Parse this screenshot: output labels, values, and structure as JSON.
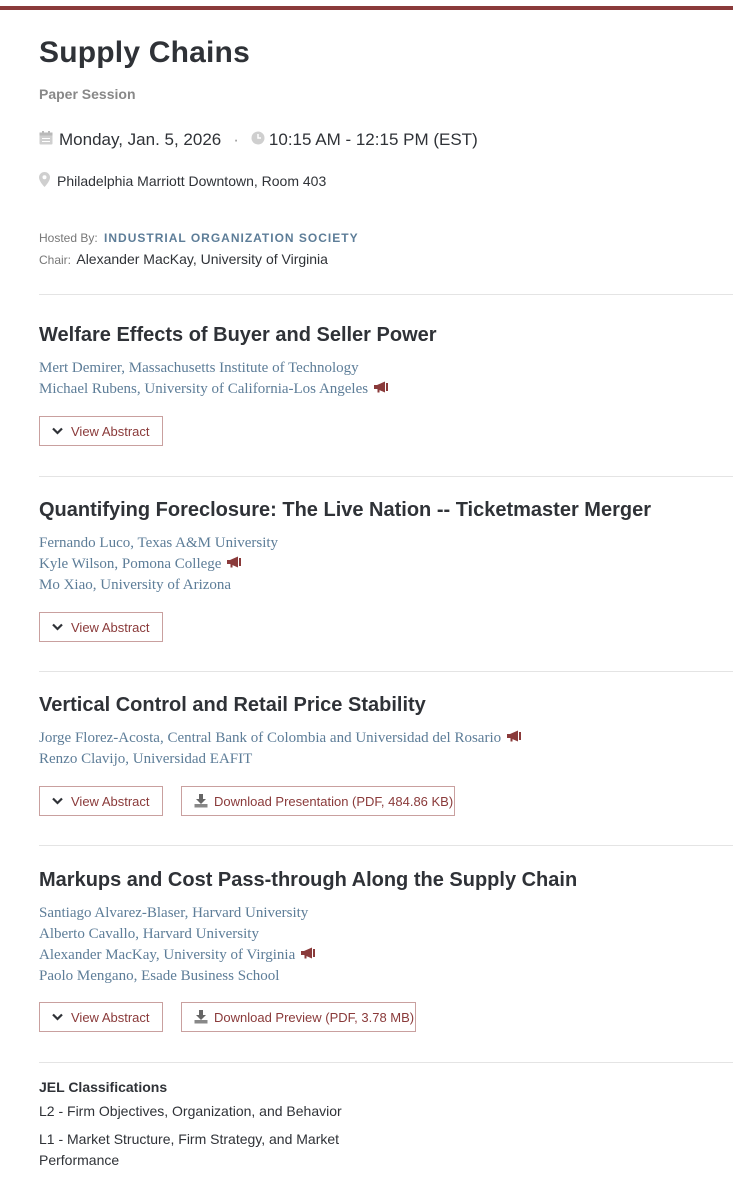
{
  "session": {
    "title": "Supply Chains",
    "type": "Paper Session",
    "date": "Monday, Jan. 5, 2026",
    "separator": "·",
    "time": "10:15 AM - 12:15 PM (EST)",
    "location": "Philadelphia Marriott Downtown, Room 403",
    "hosted_label": "Hosted By:",
    "hosted_by": "INDUSTRIAL ORGANIZATION SOCIETY",
    "chair_label": "Chair:",
    "chair": "Alexander MacKay, University of Virginia"
  },
  "colors": {
    "accent": "#8a3a3a",
    "link": "#5d7d98",
    "text": "#2f3237",
    "muted": "#888888"
  },
  "papers": [
    {
      "title": "Welfare Effects of Buyer and Seller Power",
      "authors": [
        {
          "name": "Mert Demirer, Massachusetts Institute of Technology",
          "presenter": false
        },
        {
          "name": "Michael Rubens, University of California-Los Angeles",
          "presenter": true
        }
      ],
      "buttons": [
        {
          "label": "View Abstract",
          "icon": "chevron-down-icon"
        }
      ]
    },
    {
      "title": "Quantifying Foreclosure: The Live Nation -- Ticketmaster Merger",
      "authors": [
        {
          "name": "Fernando Luco, Texas A&M University",
          "presenter": false
        },
        {
          "name": "Kyle Wilson, Pomona College",
          "presenter": true
        },
        {
          "name": "Mo Xiao, University of Arizona",
          "presenter": false
        }
      ],
      "buttons": [
        {
          "label": "View Abstract",
          "icon": "chevron-down-icon"
        }
      ]
    },
    {
      "title": "Vertical Control and Retail Price Stability",
      "authors": [
        {
          "name": "Jorge Florez-Acosta, Central Bank of Colombia and Universidad del Rosario",
          "presenter": true
        },
        {
          "name": "Renzo Clavijo, Universidad EAFIT",
          "presenter": false
        }
      ],
      "buttons": [
        {
          "label": "View Abstract",
          "icon": "chevron-down-icon"
        },
        {
          "label": "Download Presentation (PDF, 484.86 KB)",
          "icon": "download-icon"
        }
      ]
    },
    {
      "title": "Markups and Cost Pass-through Along the Supply Chain",
      "authors": [
        {
          "name": "Santiago Alvarez-Blaser, Harvard University",
          "presenter": false
        },
        {
          "name": "Alberto Cavallo, Harvard University",
          "presenter": false
        },
        {
          "name": "Alexander MacKay, University of Virginia",
          "presenter": true
        },
        {
          "name": "Paolo Mengano, Esade Business School",
          "presenter": false
        }
      ],
      "buttons": [
        {
          "label": "View Abstract",
          "icon": "chevron-down-icon"
        },
        {
          "label": "Download Preview (PDF, 3.78 MB)",
          "icon": "download-icon"
        }
      ]
    }
  ],
  "jel": {
    "heading": "JEL Classifications",
    "items": [
      "L2 - Firm Objectives, Organization, and Behavior",
      "L1 - Market Structure, Firm Strategy, and Market Performance"
    ]
  }
}
